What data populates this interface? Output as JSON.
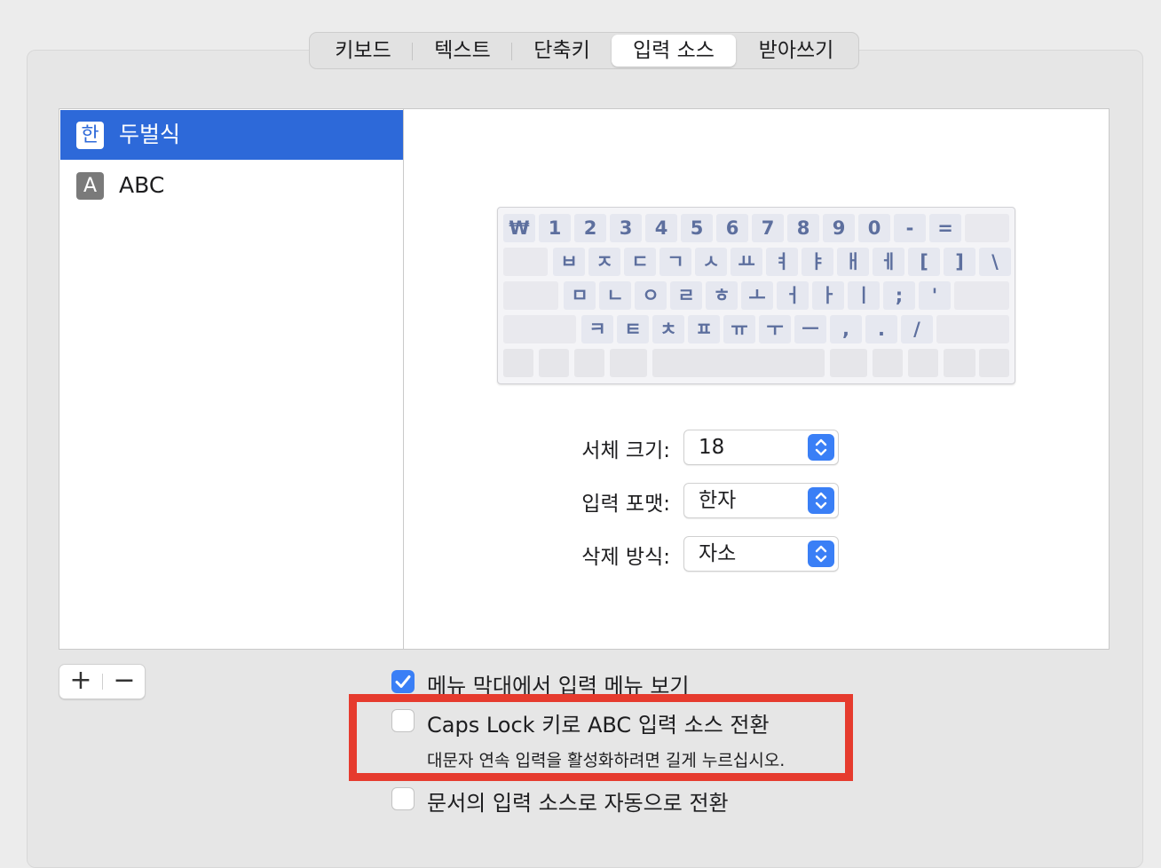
{
  "tabs": [
    {
      "label": "키보드",
      "active": false
    },
    {
      "label": "텍스트",
      "active": false
    },
    {
      "label": "단축키",
      "active": false
    },
    {
      "label": "입력 소스",
      "active": true
    },
    {
      "label": "받아쓰기",
      "active": false
    }
  ],
  "sources": [
    {
      "icon": "한",
      "label": "두벌식",
      "selected": true
    },
    {
      "icon": "A",
      "label": "ABC",
      "selected": false
    }
  ],
  "keyboard": {
    "row1": [
      "₩",
      "1",
      "2",
      "3",
      "4",
      "5",
      "6",
      "7",
      "8",
      "9",
      "0",
      "-",
      "="
    ],
    "row2": [
      "ㅂ",
      "ㅈ",
      "ㄷ",
      "ㄱ",
      "ㅅ",
      "ㅛ",
      "ㅕ",
      "ㅑ",
      "ㅐ",
      "ㅔ",
      "[",
      "]",
      "\\"
    ],
    "row3": [
      "ㅁ",
      "ㄴ",
      "ㅇ",
      "ㄹ",
      "ㅎ",
      "ㅗ",
      "ㅓ",
      "ㅏ",
      "ㅣ",
      ";",
      "'"
    ],
    "row4": [
      "ㅋ",
      "ㅌ",
      "ㅊ",
      "ㅍ",
      "ㅠ",
      "ㅜ",
      "ㅡ",
      ",",
      ".",
      "/"
    ]
  },
  "form": {
    "font_size": {
      "label": "서체 크기:",
      "value": "18"
    },
    "input_format": {
      "label": "입력 포맷:",
      "value": "한자"
    },
    "delete_mode": {
      "label": "삭제 방식:",
      "value": "자소"
    }
  },
  "list_buttons": {
    "add": "+",
    "remove": "−"
  },
  "options": {
    "show_menu": {
      "label": "메뉴 막대에서 입력 메뉴 보기",
      "checked": true
    },
    "caps_lock": {
      "label": "Caps Lock 키로 ABC 입력 소스 전환",
      "hint": "대문자 연속 입력을 활성화하려면 길게 누르십시오.",
      "checked": false
    },
    "auto_switch": {
      "label": "문서의 입력 소스로 자동으로 전환",
      "checked": false
    }
  },
  "colors": {
    "accent": "#3a7ff6",
    "selection": "#2d69d9",
    "highlight": "#e63b2e"
  }
}
